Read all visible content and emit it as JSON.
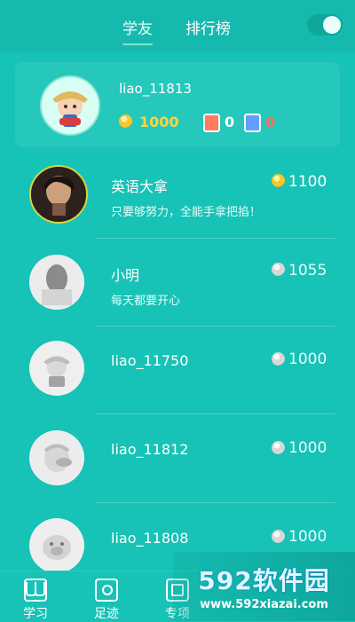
{
  "tabs": {
    "active": "学友",
    "second": "排行榜"
  },
  "profile": {
    "name": "liao_11813",
    "coins": "1000",
    "medal_1_count": "0",
    "medal_2_count": "0"
  },
  "friends": [
    {
      "name": "英语大拿",
      "subtitle": "只要够努力，全能手拿把掐！",
      "coins": "1100"
    },
    {
      "name": "小明",
      "subtitle": "每天都要开心",
      "coins": "1055"
    },
    {
      "name": "liao_11750",
      "subtitle": "",
      "coins": "1000"
    },
    {
      "name": "liao_11812",
      "subtitle": "",
      "coins": "1000"
    },
    {
      "name": "liao_11808",
      "subtitle": "",
      "coins": "1000"
    }
  ],
  "bottom_nav": [
    {
      "label": "学习"
    },
    {
      "label": "足迹"
    },
    {
      "label": "专项"
    }
  ],
  "watermark": {
    "title": "592软件园",
    "url": "www.592xiazai.com"
  },
  "colors": {
    "background": "#17c2b6",
    "card": "#25c8bb",
    "gold": "#ffd43f",
    "accent_red": "#ff6d5c"
  },
  "icons": [
    "user-avatar-icon",
    "coin-icon",
    "medal-icon",
    "book-icon",
    "footprint-icon",
    "special-icon"
  ]
}
